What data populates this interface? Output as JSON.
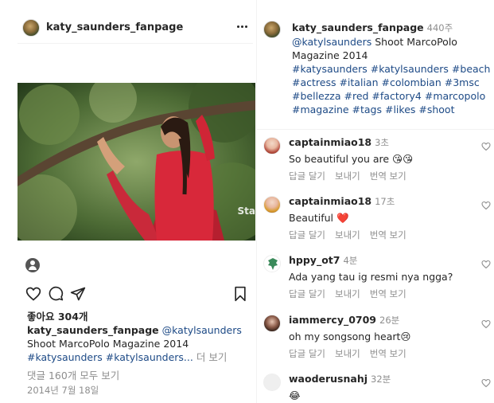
{
  "post": {
    "username": "katy_saunders_fanpage",
    "likes_label": "좋아요 304개",
    "caption_user": "katy_saunders_fanpage",
    "caption_mention": "@katylsaunders",
    "caption_line2": "Shoot MarcoPolo Magazine 2014",
    "caption_tags": "#katysaunders #katylsaunders...",
    "more_label": "더 보기",
    "comments_link": "댓글 160개 모두 보기",
    "date": "2014년 7월 18일",
    "watermark": "Sta"
  },
  "caption_full": {
    "username": "katy_saunders_fanpage",
    "time": "440주",
    "mention": "@katylsaunders",
    "text": "Shoot MarcoPolo Magazine 2014",
    "tags": "#katysaunders #katylsaunders #beach #actress #italian #colombian #3msc #bellezza #red #factory4 #marcopolo #magazine #tags #likes #shoot"
  },
  "comment_actions": {
    "reply": "답글 달기",
    "send": "보내기",
    "translate": "번역 보기"
  },
  "comments": [
    {
      "username": "captainmiao18",
      "time": "3초",
      "text": "So beautiful you are 😘😘"
    },
    {
      "username": "captainmiao18",
      "time": "17초",
      "text": "Beautiful ❤️"
    },
    {
      "username": "hppy_ot7",
      "time": "4분",
      "text": "Ada yang tau ig resmi nya ngga?"
    },
    {
      "username": "iammercy_0709",
      "time": "26분",
      "text": "oh my songsong heart😢"
    },
    {
      "username": "waoderusnahj",
      "time": "32분",
      "text": "😂"
    }
  ],
  "icons": [
    "more-icon",
    "user-tag-icon",
    "heart-icon",
    "comment-icon",
    "share-icon",
    "bookmark-icon",
    "like-comment-icon"
  ],
  "colors": {
    "link_blue": "#1d4a86",
    "muted": "#8e8e8e",
    "dress_red": "#d8283a"
  }
}
